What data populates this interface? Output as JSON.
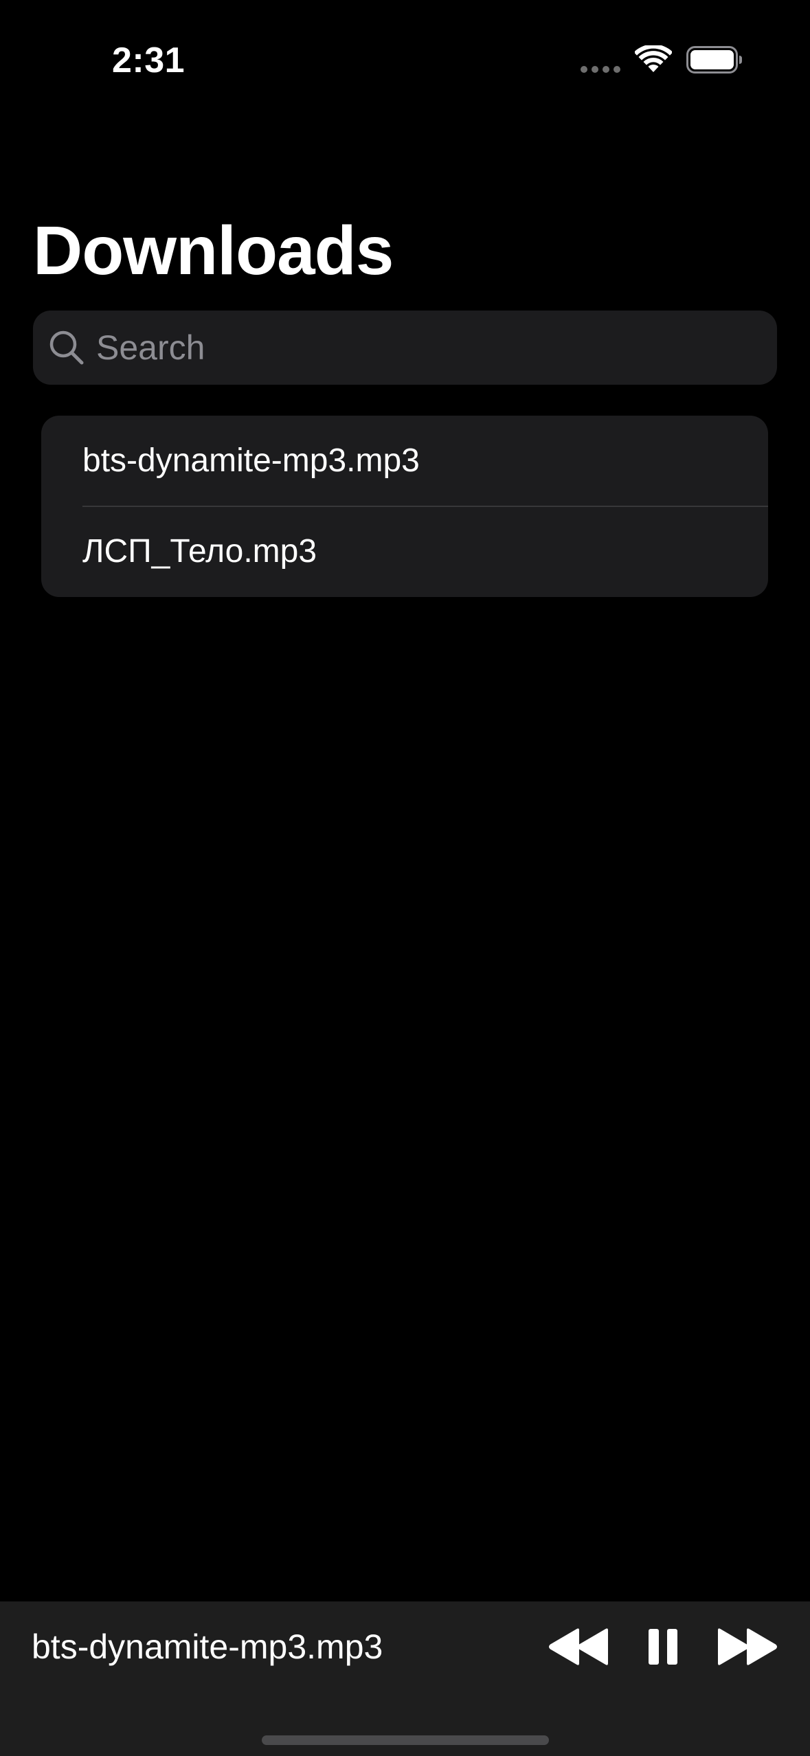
{
  "status_bar": {
    "time": "2:31",
    "signal_icon": "cellular-signal-dots",
    "wifi_icon": "wifi-icon",
    "battery_icon": "battery-full-icon"
  },
  "header": {
    "title": "Downloads"
  },
  "search": {
    "placeholder": "Search",
    "value": "",
    "icon": "magnifying-glass"
  },
  "files": [
    {
      "name": "bts-dynamite-mp3.mp3"
    },
    {
      "name": "ЛСП_Тело.mp3"
    }
  ],
  "player": {
    "now_playing": "bts-dynamite-mp3.mp3",
    "controls": [
      "rewind-icon",
      "pause-icon",
      "fast-forward-icon"
    ]
  },
  "colors": {
    "background": "#000000",
    "surface": "#1c1c1e",
    "player_surface": "#1e1e1e",
    "text_primary": "#ffffff",
    "text_placeholder": "#8d8d93",
    "divider": "#38383a"
  }
}
